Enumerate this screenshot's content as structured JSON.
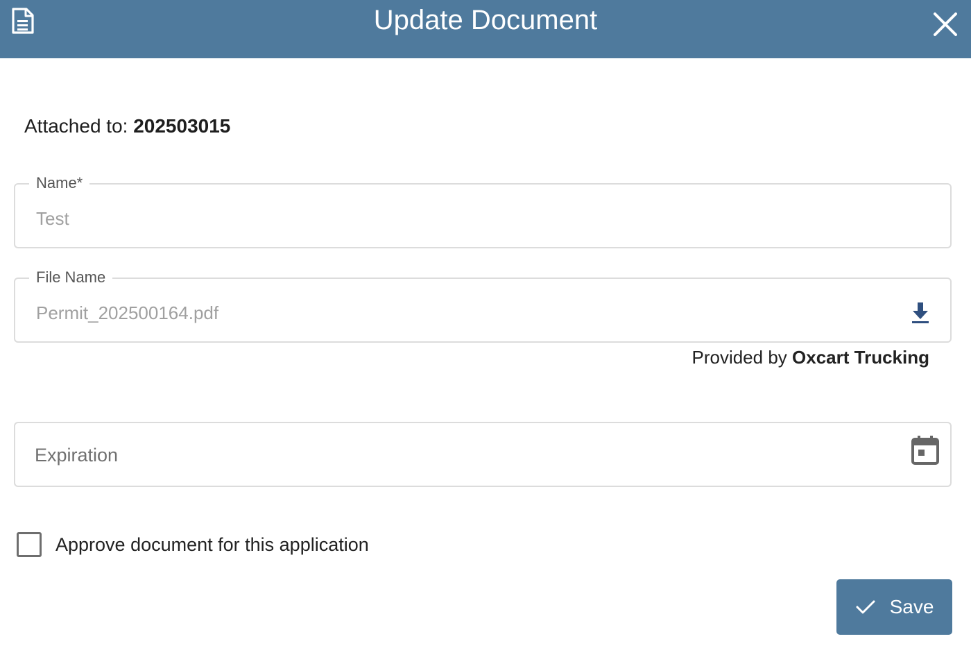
{
  "dialog": {
    "title": "Update Document",
    "icons": {
      "header": "document-icon",
      "close": "close-icon"
    }
  },
  "attached": {
    "label": "Attached to:",
    "value": "202503015"
  },
  "name_field": {
    "label": "Name*",
    "value": "Test"
  },
  "file_field": {
    "label": "File Name",
    "value": "Permit_202500164.pdf",
    "icon": "download-icon"
  },
  "provider": {
    "prefix": "Provided by",
    "name": "Oxcart Trucking"
  },
  "expiration_field": {
    "placeholder": "Expiration",
    "icon": "calendar-icon"
  },
  "approve": {
    "label": "Approve document for this application",
    "checked": false
  },
  "actions": {
    "save_label": "Save",
    "save_icon": "check-icon"
  },
  "colors": {
    "header": "#4f7a9d",
    "save_button": "#4f7a9d",
    "download_icon": "#2f4f7f",
    "field_border": "#dcdcdc"
  }
}
